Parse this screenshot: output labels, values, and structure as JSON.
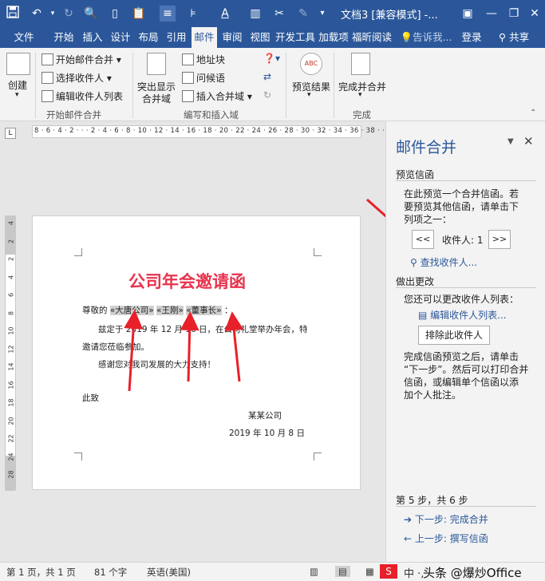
{
  "title_bar": {
    "doc_title": "文档3 [兼容模式] -..."
  },
  "tabs": [
    "文件",
    "开始",
    "插入",
    "设计",
    "布局",
    "引用",
    "邮件",
    "审阅",
    "视图",
    "开发工具",
    "加载项",
    "福昕阅读",
    "告诉我...",
    "登录",
    "共享"
  ],
  "active_tab": "邮件",
  "ribbon": {
    "create": "创建",
    "start_merge": "开始邮件合并",
    "select_recipients": "选择收件人",
    "edit_recipients": "编辑收件人列表",
    "group_start": "开始邮件合并",
    "highlight_fields": "突出显示",
    "highlight_fields2": "合并域",
    "address_block": "地址块",
    "greeting_line": "问候语",
    "insert_field": "插入合并域",
    "group_write": "编写和插入域",
    "preview_results": "预览结果",
    "finish_merge": "完成并合并",
    "group_finish": "完成"
  },
  "ruler": {
    "h_ticks": "8 · 6 · 4 · 2 · · · 2 · 4 · 6 · 8 · 10 · 12 · 14 · 16 · 18 · 20 · 22 · 24 · 26 · 28 · 30 · 32 · 34 · 36 · 38 · · 42 44 46 48",
    "v_ticks": [
      "4",
      "2",
      "2",
      "4",
      "6",
      "8",
      "10",
      "12",
      "14",
      "16",
      "18",
      "20",
      "22",
      "24",
      "28"
    ]
  },
  "document": {
    "heading": "公司年会邀请函",
    "salutation_prefix": "尊敬的",
    "field1": "«大唐公司»",
    "field2": "«王刚»",
    "field3": "«董事长»",
    "salutation_suffix": "：",
    "body1": "兹定于 2019 年 12 月 16 日，在公司礼堂举办年会，特",
    "body2": "邀请您莅临参加。",
    "body3": "感谢您对我司发展的大力支持！",
    "closing": "此致",
    "signature": "某某公司",
    "date": "2019 年 10 月 8 日"
  },
  "pane": {
    "title": "邮件合并",
    "section1": "预览信函",
    "desc1": [
      "在此预览一个合并信函。若",
      "要预览其他信函，请单击下",
      "列项之一："
    ],
    "prev_btn": "<<",
    "recipient_label": "收件人: 1",
    "next_btn": ">>",
    "find_recipient": "查找收件人...",
    "section2": "做出更改",
    "desc2": "您还可以更改收件人列表：",
    "edit_list": "编辑收件人列表...",
    "exclude_btn": "排除此收件人",
    "desc3": [
      "完成信函预览之后，请单击",
      "“下一步”。然后可以打印合并",
      "信函，或编辑单个信函以添",
      "加个人批注。"
    ],
    "step": "第 5 步，共 6 步",
    "next_step": "下一步: 完成合并",
    "prev_step": "上一步: 撰写信函"
  },
  "status_bar": {
    "page": "第 1 页，共 1 页",
    "words": "81 个字",
    "language": "英语(美国)",
    "watermark": "头条 @爆炒Office"
  },
  "colors": {
    "accent": "#2b579a",
    "heading": "#e8344e",
    "arrow": "#e8202a"
  }
}
